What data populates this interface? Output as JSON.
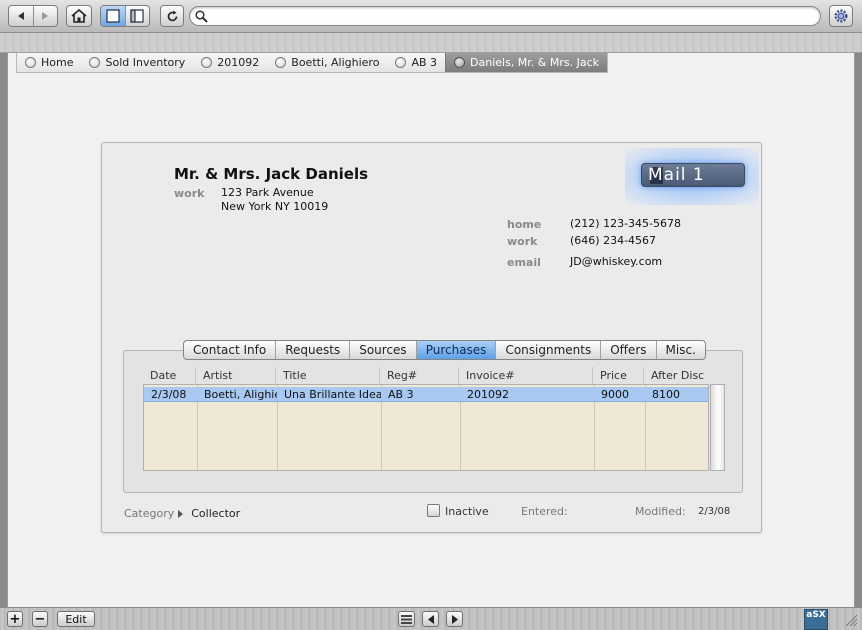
{
  "search": {
    "value": "",
    "placeholder": ""
  },
  "breadcrumbs": [
    {
      "label": "Home",
      "active": false
    },
    {
      "label": "Sold Inventory",
      "active": false
    },
    {
      "label": "201092",
      "active": false
    },
    {
      "label": "Boetti, Alighiero",
      "active": false
    },
    {
      "label": "AB 3",
      "active": false
    },
    {
      "label": "Daniels, Mr. & Mrs. Jack",
      "active": true
    }
  ],
  "contact": {
    "name": "Mr. & Mrs. Jack Daniels",
    "work_label": "work",
    "address_line1": "123 Park Avenue",
    "address_line2": "New York NY 10019",
    "phones": [
      {
        "label": "home",
        "value": "(212) 123-345-5678"
      },
      {
        "label": "work",
        "value": "(646) 234-4567"
      },
      {
        "label": "email",
        "value": "JD@whiskey.com"
      }
    ],
    "mail_button": "Mail 1"
  },
  "tabs": [
    "Contact Info",
    "Requests",
    "Sources",
    "Purchases",
    "Consignments",
    "Offers",
    "Misc."
  ],
  "active_tab": "Purchases",
  "table": {
    "columns": [
      "Date",
      "Artist",
      "Title",
      "Reg#",
      "Invoice#",
      "Price",
      "After Disc"
    ],
    "rows": [
      [
        "2/3/08",
        "Boetti, Alighie",
        "Una Brillante Idea",
        "AB 3",
        "201092",
        "9000",
        "8100"
      ]
    ]
  },
  "footer": {
    "category_label": "Category",
    "category_value": "Collector",
    "inactive_label": "Inactive",
    "inactive_checked": false,
    "entered_label": "Entered:",
    "entered_value": "",
    "modified_label": "Modified:",
    "modified_value": "2/3/08"
  },
  "bottom": {
    "add_label": "+",
    "remove_label": "−",
    "edit_label": "Edit",
    "logo_text": "aSX"
  },
  "colors": {
    "selection_blue": "#a9c8f2",
    "table_bg": "#efe8d6",
    "active_tab": "#5ea0e6",
    "mail_glow": "#8fb8f2"
  }
}
